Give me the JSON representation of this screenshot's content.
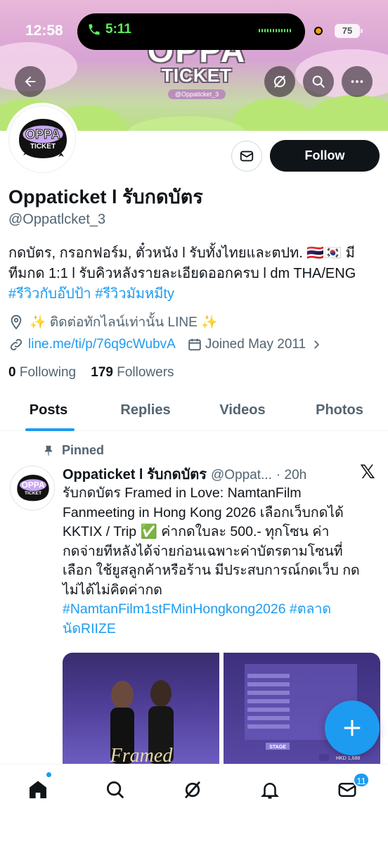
{
  "status_bar": {
    "time": "12:58",
    "call_timer": "5:11",
    "battery": "75"
  },
  "banner": {
    "logo_main": "OPPA",
    "logo_sub": "TICKET",
    "logo_handle": "@Oppaticket_3"
  },
  "profile": {
    "follow_label": "Follow",
    "display_name": "Oppaticket l รับกดบัตร",
    "username": "@Oppatlcket_3",
    "bio_line1": "กดบัตร, กรอกฟอร์ม, ตั๋วหนัง l รับทั้งไทยและตปท. 🇹🇭🇰🇷 มี",
    "bio_line2": "ทีมกด 1:1 l รับคิวหลังรายละเอียดออกครบ l dm THA/ENG",
    "bio_hashtags": "#รีวิวกับอ๊ปป้า #รีวิวมัมหมีty",
    "location": "✨ ติดต่อทักไลน์เท่านั้น LINE ✨",
    "website": "line.me/ti/p/76q9cWubvA",
    "joined": "Joined May 2011",
    "following_count": "0",
    "following_label": "Following",
    "followers_count": "179",
    "followers_label": "Followers"
  },
  "tabs": [
    {
      "label": "Posts"
    },
    {
      "label": "Replies"
    },
    {
      "label": "Videos"
    },
    {
      "label": "Photos"
    }
  ],
  "tweet": {
    "pinned_label": "Pinned",
    "author_name": "Oppaticket l รับกดบัตร",
    "author_handle": "@Oppat...",
    "time": "· 20h",
    "text_lines": [
      "รับกดบัตร Framed in Love: NamtanFilm",
      "Fanmeeting in Hong Kong 2026 เลือกเว็บกดได้",
      "KKTIX / Trip  ✅ ค่ากดใบละ 500.- ทุกโซน  ค่า",
      "กดจ่ายทีหลังได้จ่ายก่อนเฉพาะค่าบัตรตามโซนที่",
      "เลือก ใช้ยูสลูกค้าหรือร้าน มีประสบการณ์กดเว็บ กด",
      "ไม่ได้ไม่คิดค่ากด"
    ],
    "hashtag_line1": "#NamtanFilm1stFMinHongkong2026 #ตลาด",
    "hashtag_line2": "นัดRIIZE",
    "media_text_1": "Framed",
    "media_text_2": "STAGE",
    "media_text_3": "HKD 1,688"
  },
  "bottom_nav": {
    "messages_badge": "11"
  },
  "colors": {
    "accent": "#1d9bf0",
    "text": "#0f1419",
    "muted": "#536471"
  }
}
